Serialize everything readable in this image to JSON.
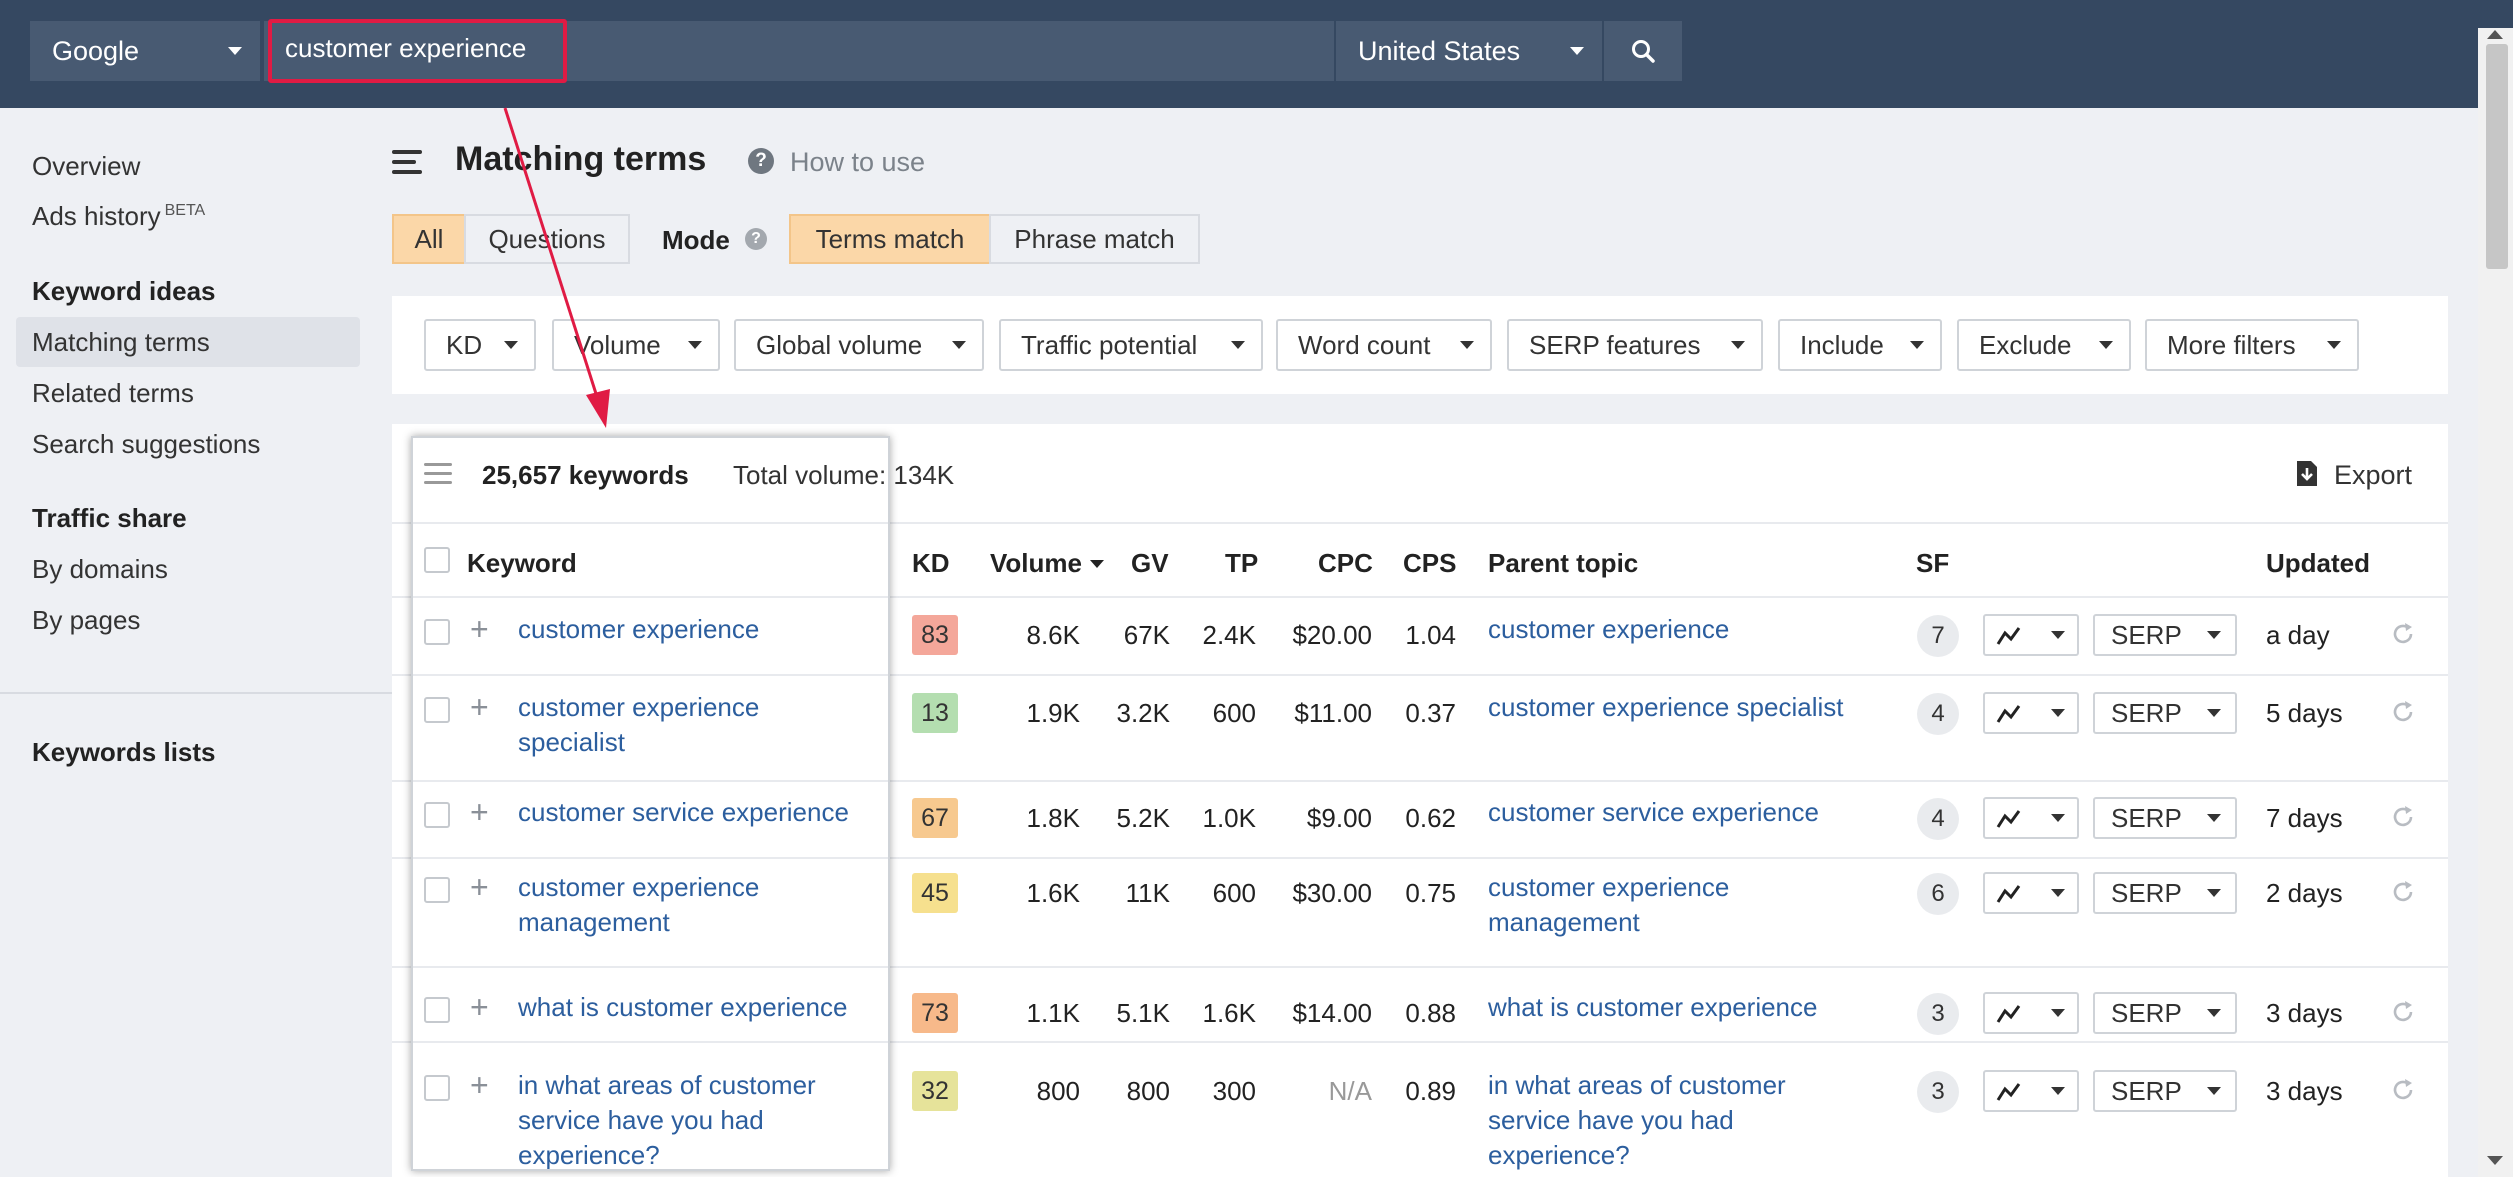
{
  "topbar": {
    "engine": "Google",
    "query": "customer experience",
    "country": "United States"
  },
  "sidebar": {
    "overview": "Overview",
    "ads_history": "Ads history",
    "ads_history_badge": "BETA",
    "keyword_ideas_heading": "Keyword ideas",
    "matching_terms": "Matching terms",
    "related_terms": "Related terms",
    "search_suggestions": "Search suggestions",
    "traffic_share_heading": "Traffic share",
    "by_domains": "By domains",
    "by_pages": "By pages",
    "keywords_lists": "Keywords lists"
  },
  "header": {
    "title": "Matching terms",
    "how_to_use": "How to use",
    "help_glyph": "?",
    "tab_all": "All",
    "tab_questions": "Questions",
    "mode_label": "Mode",
    "mode_terms": "Terms match",
    "mode_phrase": "Phrase match"
  },
  "filters": [
    "KD",
    "Volume",
    "Global volume",
    "Traffic potential",
    "Word count",
    "SERP features",
    "Include",
    "Exclude",
    "More filters"
  ],
  "summary": {
    "count": "25,657 keywords",
    "total": "Total volume: 134K",
    "export": "Export"
  },
  "columns": {
    "keyword": "Keyword",
    "kd": "KD",
    "volume": "Volume",
    "gv": "GV",
    "tp": "TP",
    "cpc": "CPC",
    "cps": "CPS",
    "parent": "Parent topic",
    "sf": "SF",
    "updated": "Updated"
  },
  "serp_label": "SERP",
  "rows": [
    {
      "kw1": "customer experience",
      "kw2": "",
      "kw3": "",
      "kd": "83",
      "kd_color": "#f4a79a",
      "vol": "8.6K",
      "gv": "67K",
      "tp": "2.4K",
      "cpc": "$20.00",
      "cps": "1.04",
      "p1": "customer experience",
      "p2": "",
      "p3": "",
      "sf": "7",
      "updated": "a day"
    },
    {
      "kw1": "customer experience",
      "kw2": "specialist",
      "kw3": "",
      "kd": "13",
      "kd_color": "#b4deb0",
      "vol": "1.9K",
      "gv": "3.2K",
      "tp": "600",
      "cpc": "$11.00",
      "cps": "0.37",
      "p1": "customer experience specialist",
      "p2": "",
      "p3": "",
      "sf": "4",
      "updated": "5 days"
    },
    {
      "kw1": "customer service experience",
      "kw2": "",
      "kw3": "",
      "kd": "67",
      "kd_color": "#f7c98f",
      "vol": "1.8K",
      "gv": "5.2K",
      "tp": "1.0K",
      "cpc": "$9.00",
      "cps": "0.62",
      "p1": "customer service experience",
      "p2": "",
      "p3": "",
      "sf": "4",
      "updated": "7 days"
    },
    {
      "kw1": "customer experience",
      "kw2": "management",
      "kw3": "",
      "kd": "45",
      "kd_color": "#f6e08e",
      "vol": "1.6K",
      "gv": "11K",
      "tp": "600",
      "cpc": "$30.00",
      "cps": "0.75",
      "p1": "customer experience",
      "p2": "management",
      "p3": "",
      "sf": "6",
      "updated": "2 days"
    },
    {
      "kw1": "what is customer experience",
      "kw2": "",
      "kw3": "",
      "kd": "73",
      "kd_color": "#f7b98a",
      "vol": "1.1K",
      "gv": "5.1K",
      "tp": "1.6K",
      "cpc": "$14.00",
      "cps": "0.88",
      "p1": "what is customer experience",
      "p2": "",
      "p3": "",
      "sf": "3",
      "updated": "3 days"
    },
    {
      "kw1": "in what areas of customer",
      "kw2": "service have you had",
      "kw3": "experience?",
      "kd": "32",
      "kd_color": "#e6e39a",
      "vol": "800",
      "gv": "800",
      "tp": "300",
      "cpc": "N/A",
      "cps": "0.89",
      "p1": "in what areas of customer",
      "p2": "service have you had",
      "p3": "experience?",
      "sf": "3",
      "updated": "3 days"
    }
  ]
}
